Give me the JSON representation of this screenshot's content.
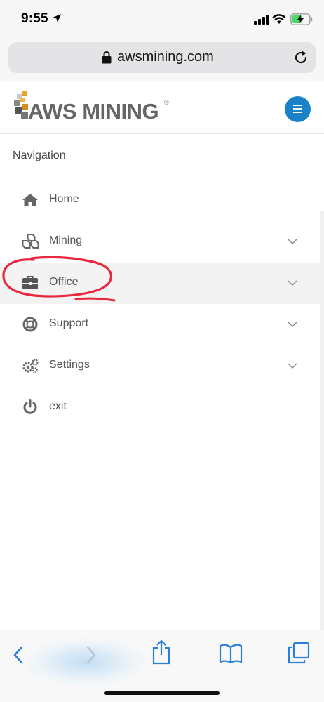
{
  "status_bar": {
    "time": "9:55"
  },
  "browser": {
    "url": "awsmining.com"
  },
  "header": {
    "logo_text": "AWS MINING",
    "logo_mark": "®",
    "brand_color": "#1a82c8"
  },
  "navigation": {
    "title": "Navigation",
    "items": [
      {
        "label": "Home",
        "icon": "home-icon",
        "expandable": false
      },
      {
        "label": "Mining",
        "icon": "cubes-icon",
        "expandable": true
      },
      {
        "label": "Office",
        "icon": "briefcase-icon",
        "expandable": true,
        "highlighted": true
      },
      {
        "label": "Support",
        "icon": "lifebuoy-icon",
        "expandable": true
      },
      {
        "label": "Settings",
        "icon": "gears-icon",
        "expandable": true
      },
      {
        "label": "exit",
        "icon": "power-icon",
        "expandable": false
      }
    ]
  },
  "annotation": {
    "color": "#e8283c"
  },
  "colors": {
    "accent": "#1a82c8",
    "ios_blue": "#2a7fd8"
  }
}
